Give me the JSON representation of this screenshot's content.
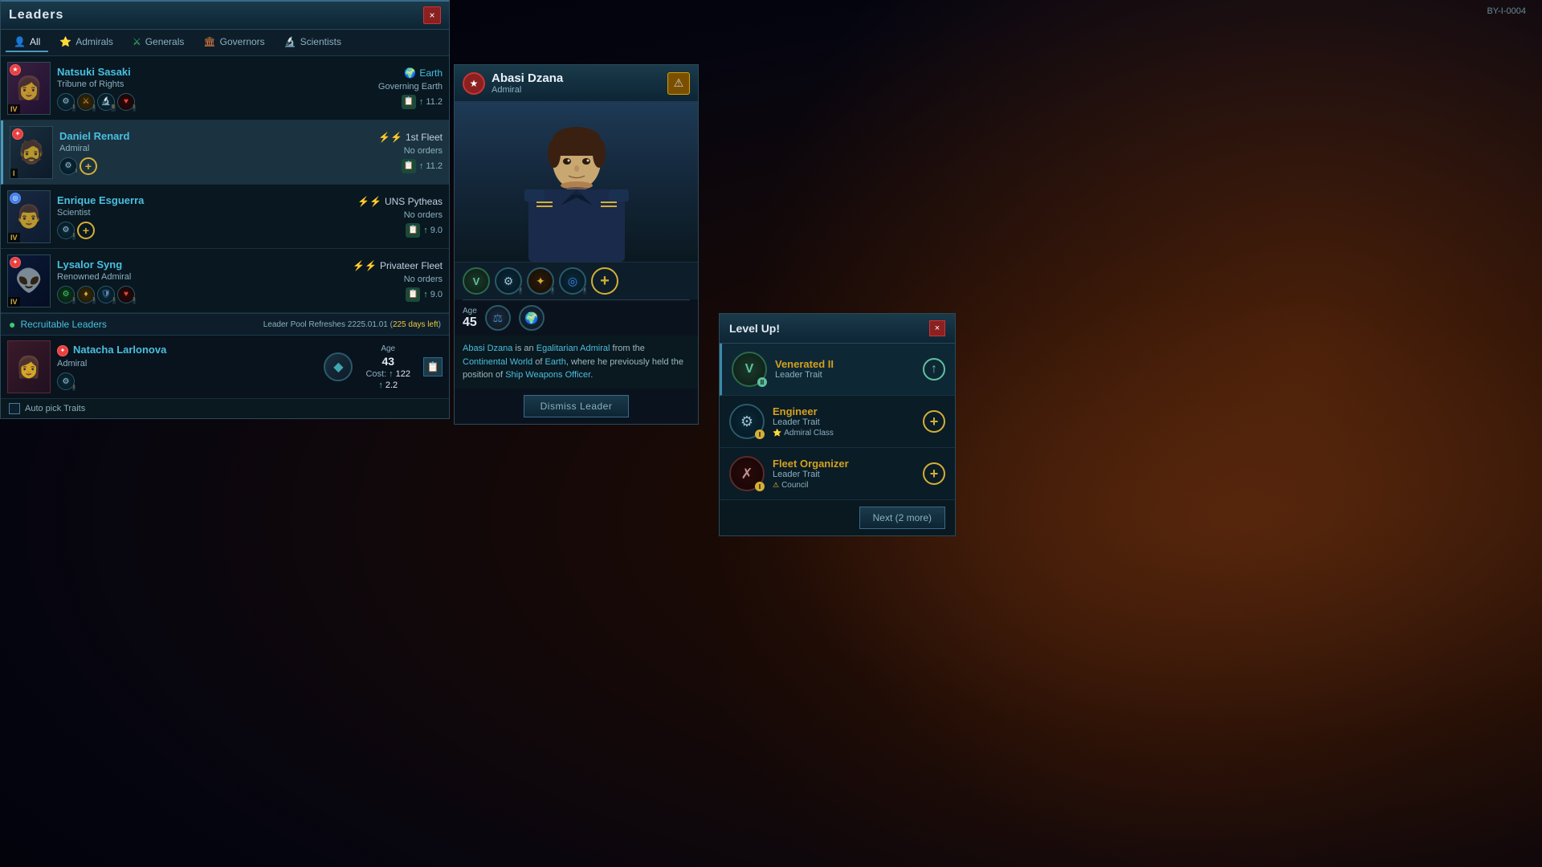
{
  "window": {
    "title": "Leaders",
    "close_label": "×"
  },
  "coord": "BY-I-0004",
  "tabs": [
    {
      "id": "all",
      "label": "All",
      "icon": "👤",
      "active": true
    },
    {
      "id": "admirals",
      "label": "Admirals",
      "icon": "⭐",
      "color": "#e84040"
    },
    {
      "id": "generals",
      "label": "Generals",
      "icon": "⚔",
      "color": "#40c870"
    },
    {
      "id": "governors",
      "label": "Governors",
      "icon": "🏛",
      "color": "#e88040"
    },
    {
      "id": "scientists",
      "label": "Scientists",
      "icon": "🔬",
      "color": "#4080e8"
    }
  ],
  "leaders": [
    {
      "name": "Natsuki Sasaki",
      "role": "Tribune of Rights",
      "portrait_emoji": "👩",
      "portrait_color": "#3a2040",
      "faction_icon": "★",
      "faction_color": "#e84040",
      "assignment": "Earth",
      "assignment_action": "Governing Earth",
      "assignment_icon": "🌍",
      "xp": "11.2",
      "level": "IV",
      "traits": [
        "⚙",
        "⚔",
        "🔬",
        "♦"
      ],
      "trait_levels": [
        "I",
        "I",
        "II",
        "I"
      ],
      "status_color": "#1a4a3a",
      "selected": false
    },
    {
      "name": "Daniel Renard",
      "role": "Admiral",
      "portrait_emoji": "🧔",
      "portrait_color": "#1a3040",
      "faction_icon": "✦",
      "faction_color": "#e84040",
      "assignment": "1st Fleet",
      "assignment_action": "No orders",
      "assignment_icon": "⚡",
      "xp": "11.2",
      "level": "I",
      "traits": [
        "⚙"
      ],
      "trait_levels": [
        "I"
      ],
      "has_add": true,
      "status_color": "#1a4a3a",
      "selected": false
    },
    {
      "name": "Enrique Esguerra",
      "role": "Scientist",
      "portrait_emoji": "👨‍🔬",
      "portrait_color": "#1a2a40",
      "faction_icon": "◎",
      "faction_color": "#4080e8",
      "assignment": "UNS Pytheas",
      "assignment_action": "No orders",
      "assignment_icon": "⚡",
      "xp": "9.0",
      "level": "IV",
      "traits": [
        "⚙"
      ],
      "trait_levels": [
        "I"
      ],
      "has_add": true,
      "status_color": "#1a4a3a",
      "selected": false
    },
    {
      "name": "Lysalor Syng",
      "role": "Renowned Admiral",
      "portrait_emoji": "👽",
      "portrait_color": "#0a1a3a",
      "faction_icon": "✦",
      "faction_color": "#e84040",
      "assignment": "Privateer Fleet",
      "assignment_action": "No orders",
      "assignment_icon": "⚡",
      "xp": "9.0",
      "level": "IV",
      "traits": [
        "⚙",
        "♦",
        "🛡",
        "♥"
      ],
      "trait_levels": [
        "I",
        "I",
        "I",
        "I"
      ],
      "status_color": "#1a4a3a",
      "selected": false
    }
  ],
  "recruitable": {
    "title": "Recruitable Leaders",
    "pool_refresh": "Leader Pool Refreshes 2225.01.01",
    "days_left": "225 days left",
    "leaders": [
      {
        "name": "Natacha Larlonova",
        "role": "Admiral",
        "portrait_emoji": "👩",
        "portrait_color": "#3a1a2a",
        "faction_icon": "✦",
        "faction_color": "#e84040",
        "age_label": "Age",
        "age": "43",
        "cost_label": "Cost:",
        "cost_unity": "122",
        "cost_xp": "2.2",
        "traits": [
          "⚙"
        ],
        "trait_levels": [
          "I"
        ]
      }
    ]
  },
  "auto_pick": {
    "label": "Auto pick Traits"
  },
  "detail": {
    "name": "Abasi Dzana",
    "role": "Admiral",
    "faction_icon": "★",
    "faction_color": "#cc3333",
    "alert_icon": "⚠",
    "age_label": "Age",
    "age": "45",
    "bio": "Abasi Dzana is an Egalitarian Admiral from the Continental World of Earth, where he previously held the position of Ship Weapons Officer.",
    "bio_highlights": [
      "Abasi Dzana",
      "Egalitarian Admiral",
      "Continental World",
      "Earth",
      "Ship Weapons Officer"
    ],
    "traits": [
      "V",
      "⚙",
      "✦",
      "◎",
      "✛"
    ],
    "trait_levels": [
      "",
      "I",
      "I",
      "I",
      ""
    ],
    "has_add": true,
    "dismiss_label": "Dismiss Leader",
    "stat_icons": [
      "⚖",
      "🌍"
    ]
  },
  "levelup": {
    "title": "Level Up!",
    "close_label": "×",
    "options": [
      {
        "name": "Venerated II",
        "type": "Leader Trait",
        "icon": "V",
        "icon_color": "#60c0a0",
        "level_badge": "II",
        "class_tag": null,
        "highlighted": true
      },
      {
        "name": "Engineer",
        "type": "Leader Trait",
        "icon": "⚙",
        "icon_color": "#a0c0d0",
        "level_badge": "I",
        "class_tag": "Admiral Class",
        "class_icon": "⭐"
      },
      {
        "name": "Fleet Organizer",
        "type": "Leader Trait",
        "icon": "✗",
        "icon_color": "#c0a0a0",
        "level_badge": "I",
        "class_tag": "Council",
        "class_icon": "⚠"
      }
    ],
    "next_label": "Next (2 more)"
  }
}
